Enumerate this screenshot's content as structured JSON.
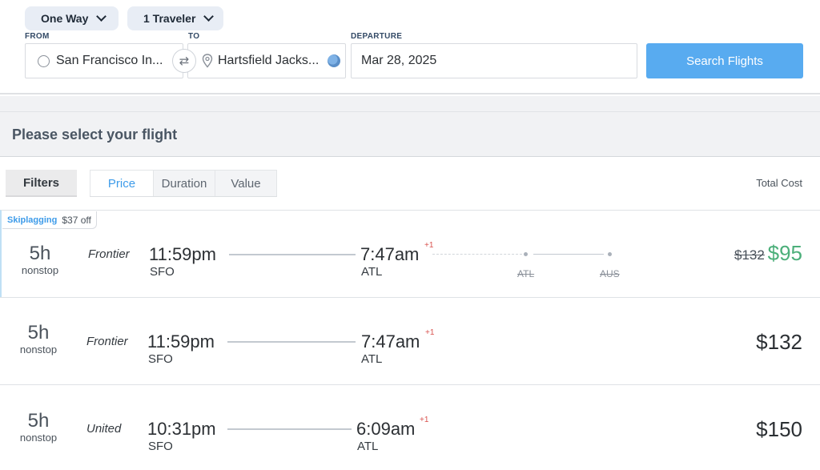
{
  "search": {
    "trip_type": "One Way",
    "travelers": "1 Traveler",
    "from_label": "FROM",
    "to_label": "TO",
    "departure_label": "DEPARTURE",
    "from_value": "San Francisco In...",
    "to_value": "Hartsfield Jacks...",
    "departure_value": "Mar 28, 2025",
    "search_button": "Search Flights"
  },
  "results_header": "Please select your flight",
  "filters": {
    "filters_button": "Filters",
    "sort_tabs": [
      "Price",
      "Duration",
      "Value"
    ],
    "active_sort": "Price",
    "total_cost_label": "Total Cost"
  },
  "flights": [
    {
      "deal_brand": "Skiplagging",
      "deal_off": "$37 off",
      "duration": "5h",
      "stops": "nonstop",
      "airline": "Frontier",
      "depart_time": "11:59pm",
      "depart_code": "SFO",
      "arrive_time": "7:47am",
      "arrive_code": "ATL",
      "day_offset": "+1",
      "hidden_stops": [
        "ATL",
        "AUS"
      ],
      "old_price": "$132",
      "price": "$95"
    },
    {
      "duration": "5h",
      "stops": "nonstop",
      "airline": "Frontier",
      "depart_time": "11:59pm",
      "depart_code": "SFO",
      "arrive_time": "7:47am",
      "arrive_code": "ATL",
      "day_offset": "+1",
      "price": "$132"
    },
    {
      "duration": "5h",
      "stops": "nonstop",
      "airline": "United",
      "depart_time": "10:31pm",
      "depart_code": "SFO",
      "arrive_time": "6:09am",
      "arrive_code": "ATL",
      "day_offset": "+1",
      "price": "$150"
    }
  ],
  "colors": {
    "accent": "#58abf0",
    "link": "#3d9be9",
    "deal_price": "#4caf7a",
    "day_offset": "#d9534f"
  },
  "icons": {
    "chevron": "chevron-down-icon",
    "origin": "circle-icon",
    "swap": "swap-icon",
    "destination": "map-pin-icon",
    "globe": "globe-icon"
  }
}
